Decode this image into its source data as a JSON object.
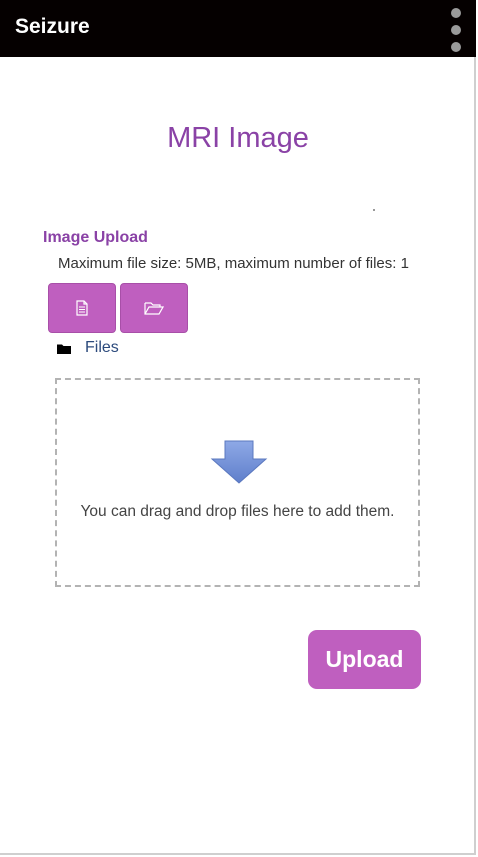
{
  "app": {
    "title": "Seizure"
  },
  "page": {
    "title": "MRI Image"
  },
  "upload_form": {
    "section_label": "Image Upload",
    "limits_text": "Maximum file size: 5MB, maximum number of files: 1",
    "file_button_icon": "document-icon",
    "folder_button_icon": "folder-open-icon",
    "files_folder_icon": "folder-icon",
    "files_label": "Files",
    "dropzone_text": "You can drag and drop files here to add them.",
    "dropzone_icon": "down-arrow-icon",
    "upload_label": "Upload"
  },
  "colors": {
    "appbar": "#050000",
    "accent": "#8a42a6",
    "button": "#bf5fbf",
    "link": "#2c4a7c",
    "arrow": "#6f8fd6"
  }
}
